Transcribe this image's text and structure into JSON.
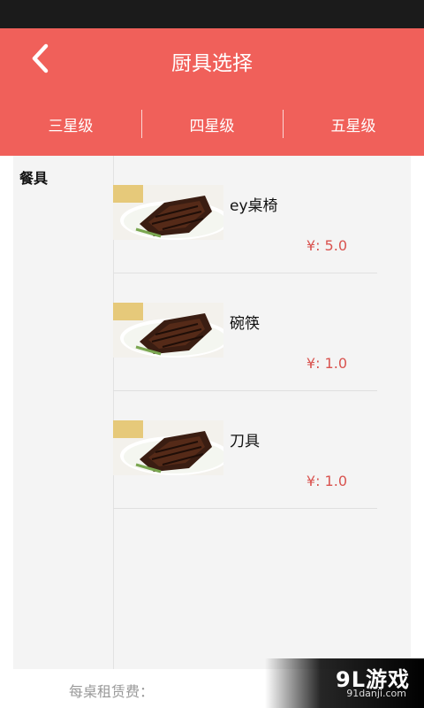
{
  "header": {
    "title": "厨具选择",
    "back_icon": "chevron-left-icon"
  },
  "tabs": [
    {
      "label": "三星级"
    },
    {
      "label": "四星级"
    },
    {
      "label": "五星级"
    }
  ],
  "categories": [
    {
      "label": "餐具"
    }
  ],
  "items": [
    {
      "name": "ey桌椅",
      "price": "¥: 5.0"
    },
    {
      "name": "碗筷",
      "price": "¥: 1.0"
    },
    {
      "name": "刀具",
      "price": "¥: 1.0"
    }
  ],
  "footer": {
    "rent_label": "每桌租赁费："
  },
  "watermark": {
    "logo": "9L游戏",
    "url": "91danji.com"
  },
  "colors": {
    "accent": "#f0605a",
    "price": "#d9534f",
    "statusbar": "#1b1b1b"
  }
}
